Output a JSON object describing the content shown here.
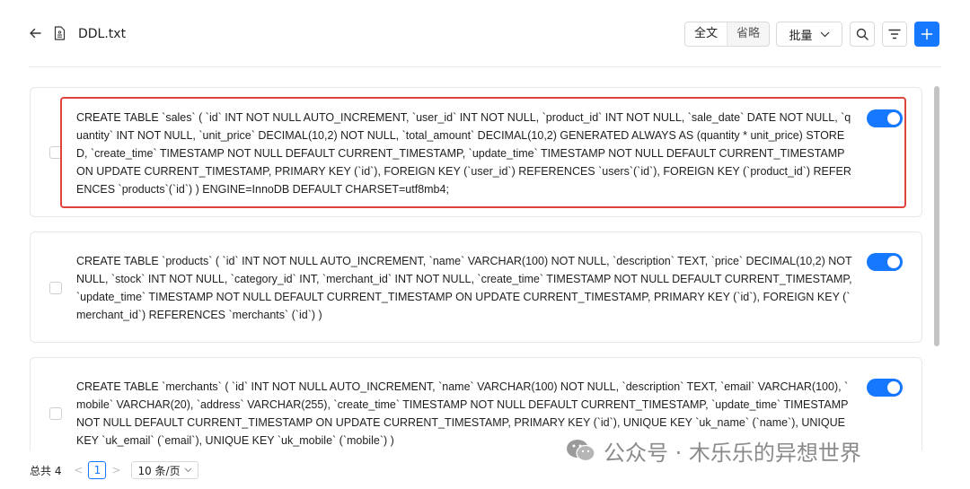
{
  "header": {
    "file_name": "DDL.txt",
    "view_modes": [
      "全文",
      "省略"
    ],
    "active_view_mode": "全文",
    "batch_label": "批量",
    "back_icon": "arrow-left-icon",
    "file_icon": "file-icon",
    "search_icon": "search-icon",
    "filter_icon": "filter-icon",
    "add_icon": "plus-icon"
  },
  "items": [
    {
      "text": "CREATE TABLE `sales` ( `id` INT NOT NULL AUTO_INCREMENT, `user_id` INT NOT NULL, `product_id` INT NOT NULL, `sale_date` DATE NOT NULL, `quantity` INT NOT NULL, `unit_price` DECIMAL(10,2) NOT NULL, `total_amount` DECIMAL(10,2) GENERATED ALWAYS AS (quantity * unit_price) STORED, `create_time` TIMESTAMP NOT NULL DEFAULT CURRENT_TIMESTAMP, `update_time` TIMESTAMP NOT NULL DEFAULT CURRENT_TIMESTAMP ON UPDATE CURRENT_TIMESTAMP, PRIMARY KEY (`id`), FOREIGN KEY (`user_id`) REFERENCES `users`(`id`), FOREIGN KEY (`product_id`) REFERENCES `products`(`id`) ) ENGINE=InnoDB DEFAULT CHARSET=utf8mb4;",
      "checked": false,
      "enabled": true,
      "highlighted": true
    },
    {
      "text": "CREATE TABLE `products` ( `id` INT NOT NULL AUTO_INCREMENT, `name` VARCHAR(100) NOT NULL, `description` TEXT, `price` DECIMAL(10,2) NOT NULL, `stock` INT NOT NULL, `category_id` INT, `merchant_id` INT NOT NULL, `create_time` TIMESTAMP NOT NULL DEFAULT CURRENT_TIMESTAMP, `update_time` TIMESTAMP NOT NULL DEFAULT CURRENT_TIMESTAMP ON UPDATE CURRENT_TIMESTAMP, PRIMARY KEY (`id`), FOREIGN KEY (`merchant_id`) REFERENCES `merchants` (`id`) )",
      "checked": false,
      "enabled": true,
      "highlighted": false
    },
    {
      "text": "CREATE TABLE `merchants` ( `id` INT NOT NULL AUTO_INCREMENT, `name` VARCHAR(100) NOT NULL, `description` TEXT, `email` VARCHAR(100), `mobile` VARCHAR(20), `address` VARCHAR(255), `create_time` TIMESTAMP NOT NULL DEFAULT CURRENT_TIMESTAMP, `update_time` TIMESTAMP NOT NULL DEFAULT CURRENT_TIMESTAMP ON UPDATE CURRENT_TIMESTAMP, PRIMARY KEY (`id`), UNIQUE KEY `uk_name` (`name`), UNIQUE KEY `uk_email` (`email`), UNIQUE KEY `uk_mobile` (`mobile`) )",
      "checked": false,
      "enabled": true,
      "highlighted": false
    }
  ],
  "pagination": {
    "total_label": "总共 4",
    "prev": "<",
    "current_page": "1",
    "next": ">",
    "page_size": "10 条/页"
  },
  "watermark": {
    "text": "公众号 · 木乐乐的异想世界"
  },
  "colors": {
    "accent": "#1677ff",
    "highlight_border": "#e0433b"
  }
}
